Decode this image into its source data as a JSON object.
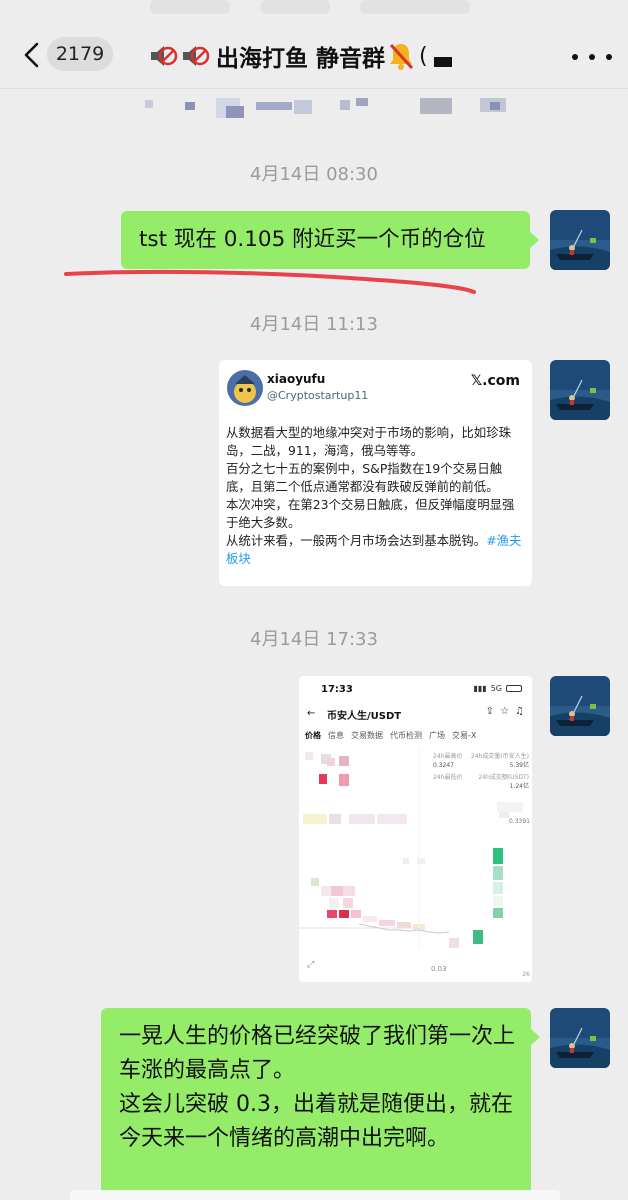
{
  "header": {
    "unread_count": "2179",
    "chat_title": "出海打鱼 静音群",
    "title_tail": "("
  },
  "messages": [
    {
      "timestamp": "4月14日 08:30",
      "text": "tst 现在 0.105 附近买一个币的仓位"
    },
    {
      "timestamp": "4月14日 11:13",
      "tweet": {
        "display_name": "xiaoyufu",
        "handle": "@Cryptostartup11",
        "source": "𝕏.com",
        "lines": [
          "从数据看大型的地缘冲突对于市场的影响，比如珍珠岛，二战，911，海湾，俄乌等等。",
          "百分之七十五的案例中，S&P指数在19个交易日触底，且第二个低点通常都没有跌破反弹前的前低。",
          "本次冲突，在第23个交易日触底，但反弹幅度明显强于绝大多数。",
          "从统计来看，一般两个月市场会达到基本脱钩。"
        ],
        "hashtag": "#渔夫板块"
      }
    },
    {
      "timestamp": "4月14日 17:33",
      "screenshot": {
        "time": "17:33",
        "network": "5G",
        "pair": "币安人生/USDT",
        "tabs": [
          "价格",
          "信息",
          "交易数据",
          "代币检测",
          "广场",
          "交易-X"
        ],
        "stats": [
          {
            "label": "24h最高价",
            "value": "0.3247"
          },
          {
            "label": "24h成交量(币安人生)",
            "value": "5.39亿"
          },
          {
            "label": "24h最低价",
            "value": ""
          },
          {
            "label": "24h成交额(USDT)",
            "value": "1.24亿"
          }
        ],
        "price_tag": "0.3391",
        "bottom_tag": "0.03",
        "corner_tag": "26"
      }
    },
    {
      "text_lines": [
        "一晃人生的价格已经突破了我们第一次上车涨的最高点了。",
        "这会儿突破 0.3，出着就是随便出，就在今天来一个情绪的高潮中出完啊。"
      ]
    }
  ],
  "colors": {
    "background": "#ededed",
    "bubble_green": "#95ec69",
    "timestamp_gray": "#9b9b9b",
    "annotation_red": "#e8434b",
    "hashtag_blue": "#1d9bf0"
  }
}
